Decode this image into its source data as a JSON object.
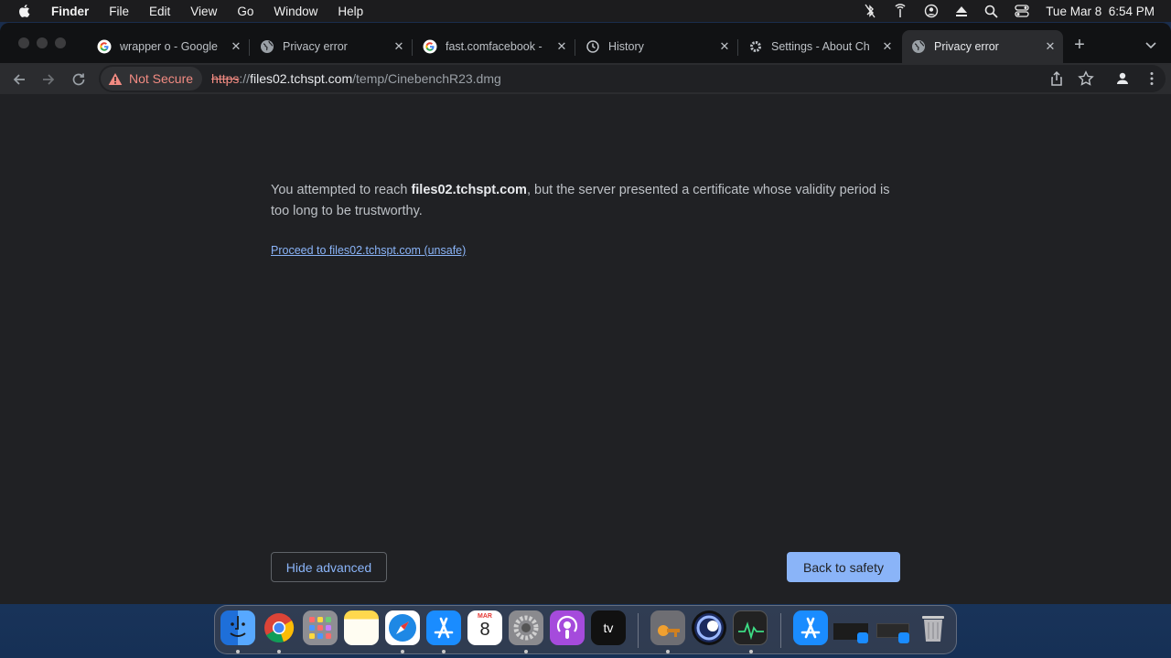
{
  "menubar": {
    "app_name": "Finder",
    "items": [
      "File",
      "Edit",
      "View",
      "Go",
      "Window",
      "Help"
    ],
    "clock": "Tue Mar 8  6:54 PM"
  },
  "tabs": [
    {
      "title": "wrapper o - Google",
      "icon": "google-icon"
    },
    {
      "title": "Privacy error",
      "icon": "globe-icon"
    },
    {
      "title": "fast.comfacebook -",
      "icon": "google-icon"
    },
    {
      "title": "History",
      "icon": "history-icon"
    },
    {
      "title": "Settings - About Ch",
      "icon": "gear-icon"
    },
    {
      "title": "Privacy error",
      "icon": "globe-icon",
      "active": true
    }
  ],
  "omnibox": {
    "security_label": "Not Secure",
    "url_scheme": "https",
    "url_sep": "://",
    "url_host": "files02.tchspt.com",
    "url_path": "/temp/CinebenchR23.dmg"
  },
  "page": {
    "message_pre": "You attempted to reach ",
    "message_host": "files02.tchspt.com",
    "message_post": ", but the server presented a certificate whose validity period is too long to be trustworthy.",
    "proceed_link": "Proceed to files02.tchspt.com (unsafe)",
    "hide_advanced": "Hide advanced",
    "back_to_safety": "Back to safety"
  },
  "dock": {
    "calendar_month": "MAR",
    "calendar_day": "8",
    "tv_label": "tv"
  },
  "colors": {
    "accent_blue": "#8ab4f8",
    "danger_red": "#f28b82",
    "page_bg": "#202124"
  }
}
